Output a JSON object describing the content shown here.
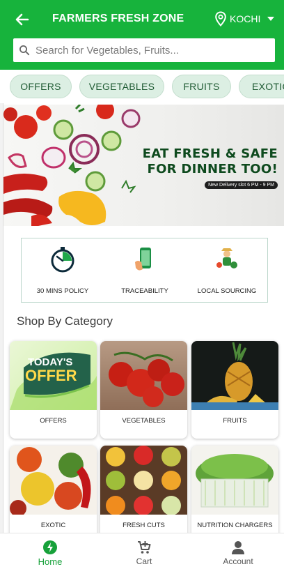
{
  "header": {
    "title": "FARMERS FRESH ZONE",
    "location": "KOCHI",
    "back_icon": "arrow-left-icon",
    "location_icon": "map-pin-icon",
    "color": "#17b33c"
  },
  "search": {
    "placeholder": "Search for Vegetables, Fruits...",
    "value": ""
  },
  "chips": [
    "OFFERS",
    "VEGETABLES",
    "FRUITS",
    "EXOTIC"
  ],
  "banner": {
    "line1": "EAT FRESH & SAFE",
    "line2": "FOR DINNER TOO!",
    "slot": "New Delivery slot 6 PM - 9 PM"
  },
  "features": [
    {
      "label": "30 MINS POLICY",
      "icon": "stopwatch-icon"
    },
    {
      "label": "TRACEABILITY",
      "icon": "phone-trace-icon"
    },
    {
      "label": "LOCAL SOURCING",
      "icon": "farmer-icon"
    }
  ],
  "section": {
    "title": "Shop By Category"
  },
  "categories": [
    {
      "label": "OFFERS",
      "badge_line1": "TODAY'S",
      "badge_line2": "OFFER"
    },
    {
      "label": "VEGETABLES"
    },
    {
      "label": "FRUITS"
    },
    {
      "label": "EXOTIC"
    },
    {
      "label": "FRESH CUTS"
    },
    {
      "label": "NUTRITION CHARGERS"
    }
  ],
  "bottom_nav": [
    {
      "label": "Home",
      "icon": "home-bolt-icon",
      "active": true
    },
    {
      "label": "Cart",
      "icon": "cart-icon",
      "active": false
    },
    {
      "label": "Account",
      "icon": "user-icon",
      "active": false
    }
  ]
}
